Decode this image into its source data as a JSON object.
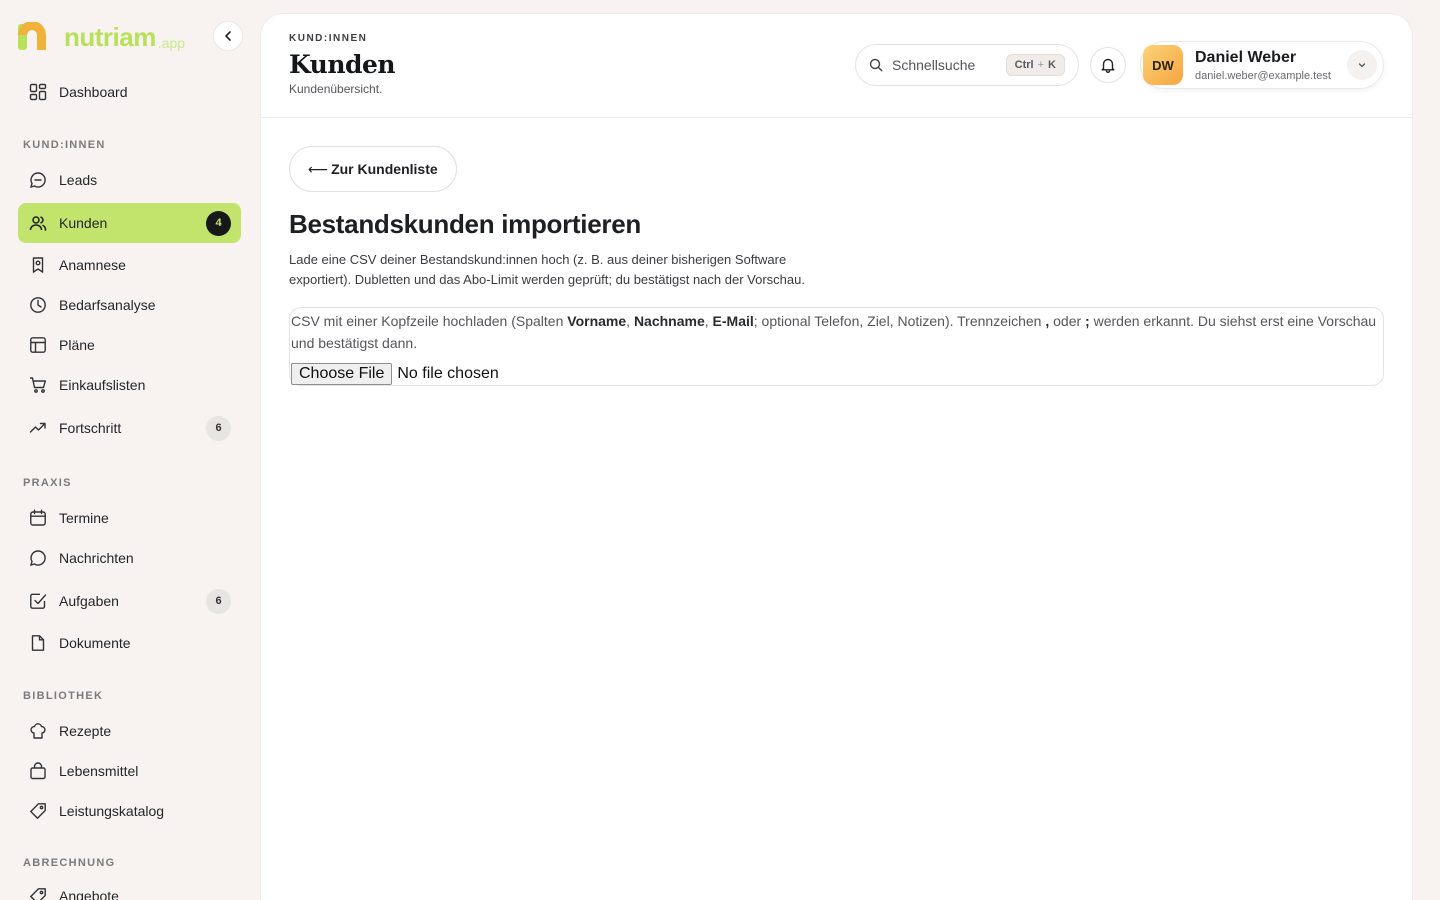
{
  "brand": {
    "name": "nutriam",
    "suffix": ".app"
  },
  "sidebar": {
    "dashboard": {
      "label": "Dashboard"
    },
    "sections": [
      {
        "title": "KUND:INNEN"
      },
      {
        "title": "PRAXIS"
      },
      {
        "title": "BIBLIOTHEK"
      },
      {
        "title": "ABRECHNUNG"
      }
    ],
    "items": [
      {
        "label": "Leads"
      },
      {
        "label": "Kunden",
        "badge": "4",
        "active": true
      },
      {
        "label": "Anamnese"
      },
      {
        "label": "Bedarfsanalyse"
      },
      {
        "label": "Pläne"
      },
      {
        "label": "Einkaufslisten"
      },
      {
        "label": "Fortschritt",
        "badge": "6"
      },
      {
        "label": "Termine"
      },
      {
        "label": "Nachrichten"
      },
      {
        "label": "Aufgaben",
        "badge": "6"
      },
      {
        "label": "Dokumente"
      },
      {
        "label": "Rezepte"
      },
      {
        "label": "Lebensmittel"
      },
      {
        "label": "Leistungskatalog"
      },
      {
        "label": "Angebote"
      }
    ]
  },
  "header": {
    "eyebrow": "KUND:INNEN",
    "title": "Kunden",
    "subtitle": "Kundenübersicht.",
    "search_placeholder": "Schnellsuche",
    "shortcut_key1": "Ctrl",
    "shortcut_plus": "+",
    "shortcut_key2": "K"
  },
  "user": {
    "initials": "DW",
    "name": "Daniel Weber",
    "email": "daniel.weber@example.test"
  },
  "content": {
    "back_arrow": "⟵",
    "back_label": "Zur Kundenliste",
    "title": "Bestandskunden importieren",
    "description": "Lade eine CSV deiner Bestandskund:innen hoch (z. B. aus deiner bisherigen Software exportiert). Dubletten und das Abo-Limit werden geprüft; du bestätigst nach der Vorschau.",
    "hint_prefix": "CSV mit einer Kopfzeile hochladen (Spalten ",
    "hint_col1": "Vorname",
    "hint_sep1": ", ",
    "hint_col2": "Nachname",
    "hint_sep2": ", ",
    "hint_col3": "E-Mail",
    "hint_middle": "; optional Telefon, Ziel, Notizen). Trennzeichen ",
    "hint_delim1": ",",
    "hint_or": " oder ",
    "hint_delim2": ";",
    "hint_suffix": " werden erkannt. Du siehst erst eine Vorschau und bestätigst dann.",
    "choose_file_label": "Choose File",
    "file_status": "No file chosen"
  }
}
